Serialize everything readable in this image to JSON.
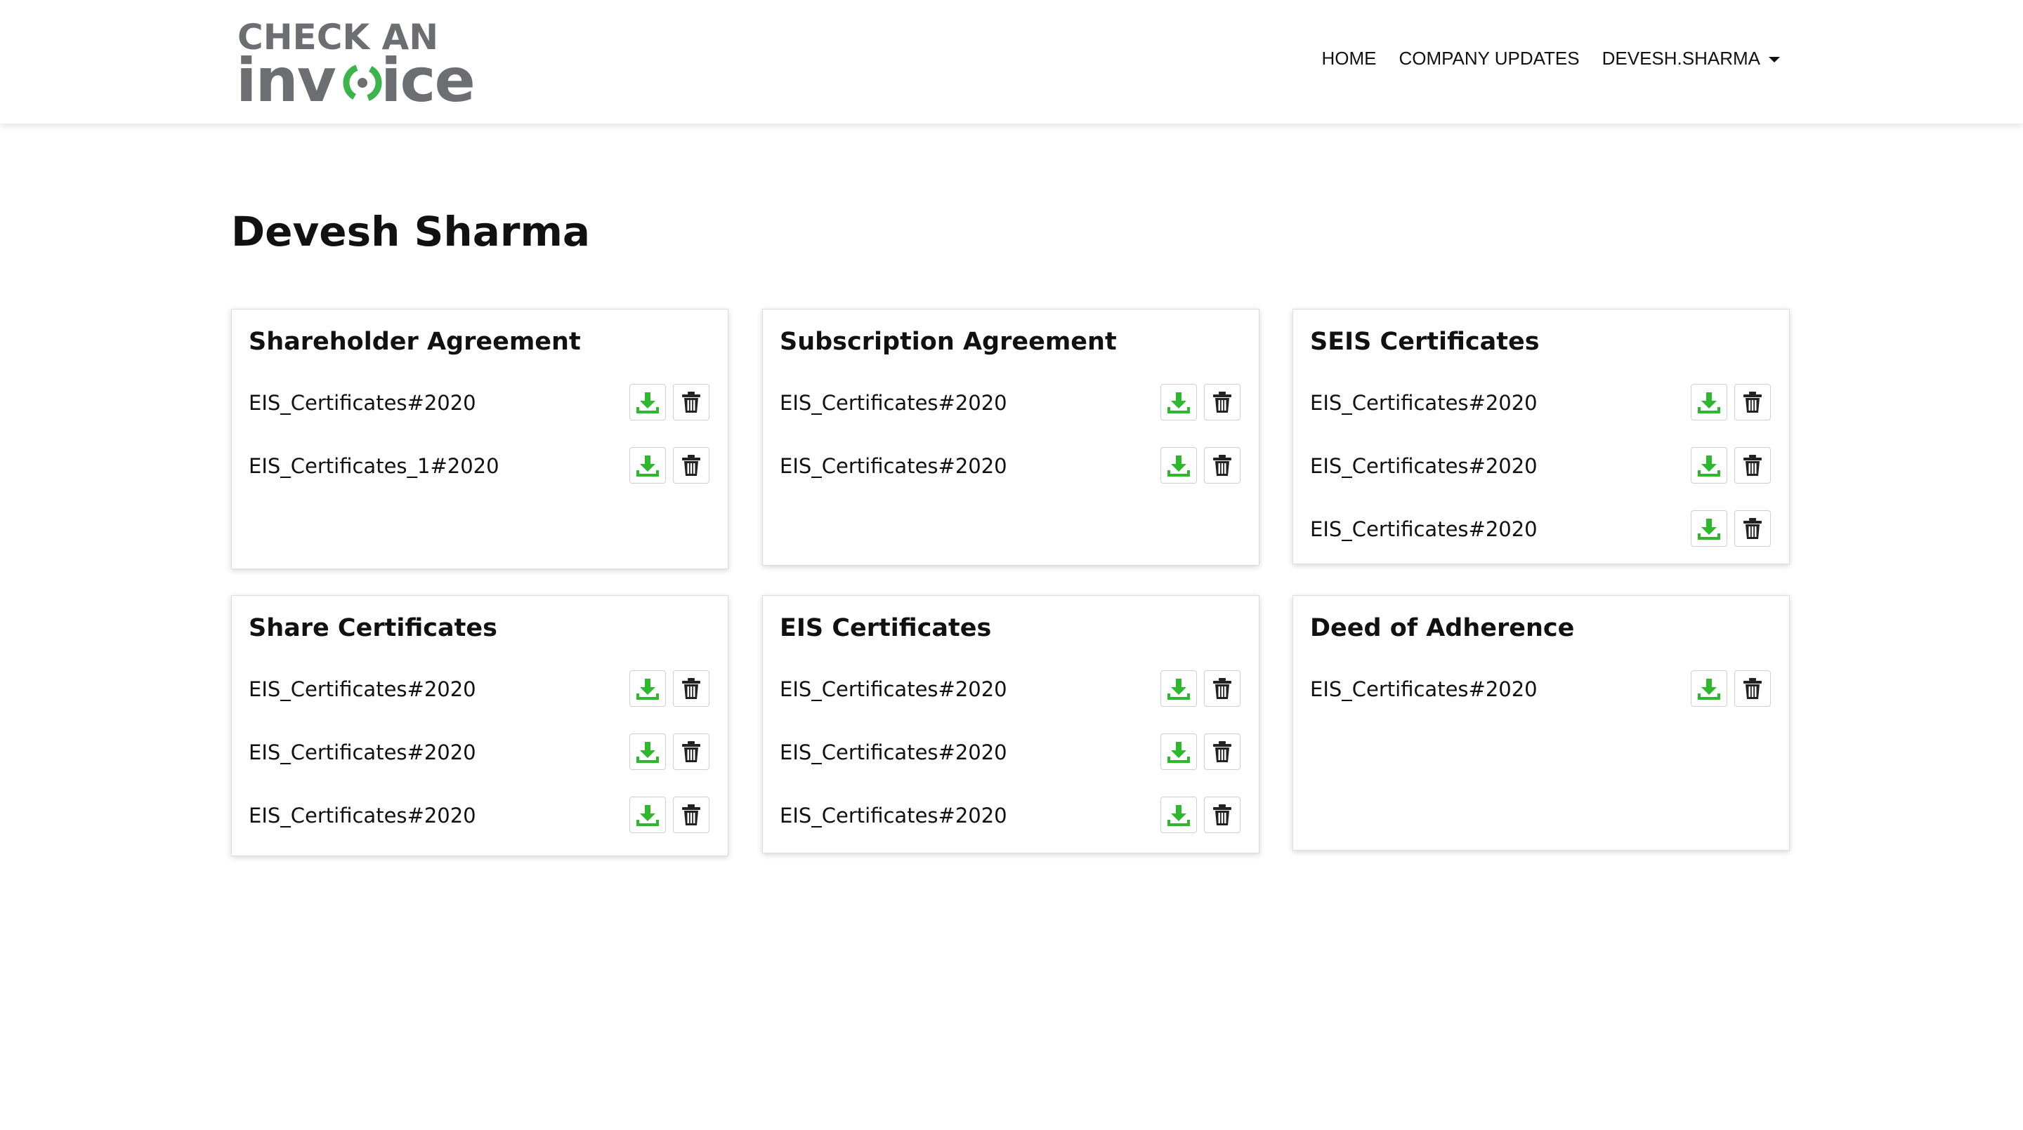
{
  "brand": {
    "logo_line1": "CHECK AN",
    "logo_line2": "invoice",
    "green": "#3cb44b",
    "gray": "#6d6e71"
  },
  "nav": {
    "home": "HOME",
    "company_updates": "COMPANY UPDATES",
    "user": "DEVESH.SHARMA"
  },
  "page": {
    "title": "Devesh Sharma"
  },
  "icons": {
    "download": "download-icon",
    "delete": "trash-icon"
  },
  "colors": {
    "download_green": "#2eb82e",
    "trash": "#222222"
  },
  "cards": [
    {
      "title": "Shareholder Agreement",
      "documents": [
        "EIS_Certificates#2020",
        "EIS_Certificates_1#2020"
      ]
    },
    {
      "title": "Subscription Agreement",
      "documents": [
        "EIS_Certificates#2020",
        "EIS_Certificates#2020"
      ]
    },
    {
      "title": "SEIS Certificates",
      "documents": [
        "EIS_Certificates#2020",
        "EIS_Certificates#2020",
        "EIS_Certificates#2020"
      ]
    },
    {
      "title": "Share Certificates",
      "documents": [
        "EIS_Certificates#2020",
        "EIS_Certificates#2020",
        "EIS_Certificates#2020"
      ]
    },
    {
      "title": "EIS Certificates",
      "documents": [
        "EIS_Certificates#2020",
        "EIS_Certificates#2020",
        "EIS_Certificates#2020"
      ]
    },
    {
      "title": "Deed of Adherence",
      "documents": [
        "EIS_Certificates#2020"
      ]
    }
  ]
}
